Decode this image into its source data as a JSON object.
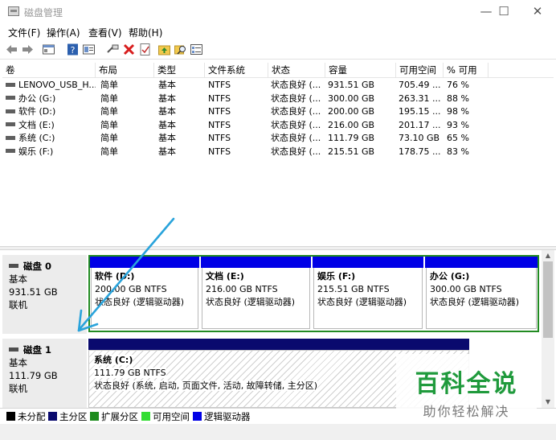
{
  "window": {
    "title": "磁盘管理",
    "minimize": "—",
    "maximize": "☐",
    "close": "✕"
  },
  "menu": [
    "文件(F)",
    "操作(A)",
    "查看(V)",
    "帮助(H)"
  ],
  "table": {
    "headers": [
      "卷",
      "布局",
      "类型",
      "文件系统",
      "状态",
      "容量",
      "可用空间",
      "% 可用"
    ],
    "rows": [
      [
        "LENOVO_USB_H...",
        "简单",
        "基本",
        "NTFS",
        "状态良好 (...",
        "931.51 GB",
        "705.49 ...",
        "76 %"
      ],
      [
        "办公 (G:)",
        "简单",
        "基本",
        "NTFS",
        "状态良好 (...",
        "300.00 GB",
        "263.31 ...",
        "88 %"
      ],
      [
        "软件 (D:)",
        "简单",
        "基本",
        "NTFS",
        "状态良好 (...",
        "200.00 GB",
        "195.15 ...",
        "98 %"
      ],
      [
        "文档 (E:)",
        "简单",
        "基本",
        "NTFS",
        "状态良好 (...",
        "216.00 GB",
        "201.17 ...",
        "93 %"
      ],
      [
        "系统 (C:)",
        "简单",
        "基本",
        "NTFS",
        "状态良好 (...",
        "111.79 GB",
        "73.10 GB",
        "65 %"
      ],
      [
        "娱乐 (F:)",
        "简单",
        "基本",
        "NTFS",
        "状态良好 (...",
        "215.51 GB",
        "178.75 ...",
        "83 %"
      ]
    ]
  },
  "disks": [
    {
      "name": "磁盘 0",
      "type": "基本",
      "size": "931.51 GB",
      "status": "联机",
      "partitions": [
        {
          "name": "软件 (D:)",
          "size": "200.00 GB NTFS",
          "status": "状态良好 (逻辑驱动器)"
        },
        {
          "name": "文档 (E:)",
          "size": "216.00 GB NTFS",
          "status": "状态良好 (逻辑驱动器)"
        },
        {
          "name": "娱乐 (F:)",
          "size": "215.51 GB NTFS",
          "status": "状态良好 (逻辑驱动器)"
        },
        {
          "name": "办公 (G:)",
          "size": "300.00 GB NTFS",
          "status": "状态良好 (逻辑驱动器)"
        }
      ]
    },
    {
      "name": "磁盘 1",
      "type": "基本",
      "size": "111.79 GB",
      "status": "联机",
      "partitions": [
        {
          "name": "系统 (C:)",
          "size": "111.79 GB NTFS",
          "status": "状态良好 (系统, 启动, 页面文件, 活动, 故障转储, 主分区)"
        }
      ]
    }
  ],
  "legend": [
    {
      "label": "未分配",
      "color": "#000000"
    },
    {
      "label": "主分区",
      "color": "#0a0a6e"
    },
    {
      "label": "扩展分区",
      "color": "#1e8c1e"
    },
    {
      "label": "可用空间",
      "color": "#33dd33"
    },
    {
      "label": "逻辑驱动器",
      "color": "#0000e6"
    }
  ],
  "watermark": {
    "main": "百科全说",
    "sub": "助你轻松解决"
  },
  "colors": {
    "logical": "#0000e6",
    "primary": "#0a0a6e",
    "extended_frame": "#228b22",
    "annotation_arrow": "#29a3db"
  }
}
